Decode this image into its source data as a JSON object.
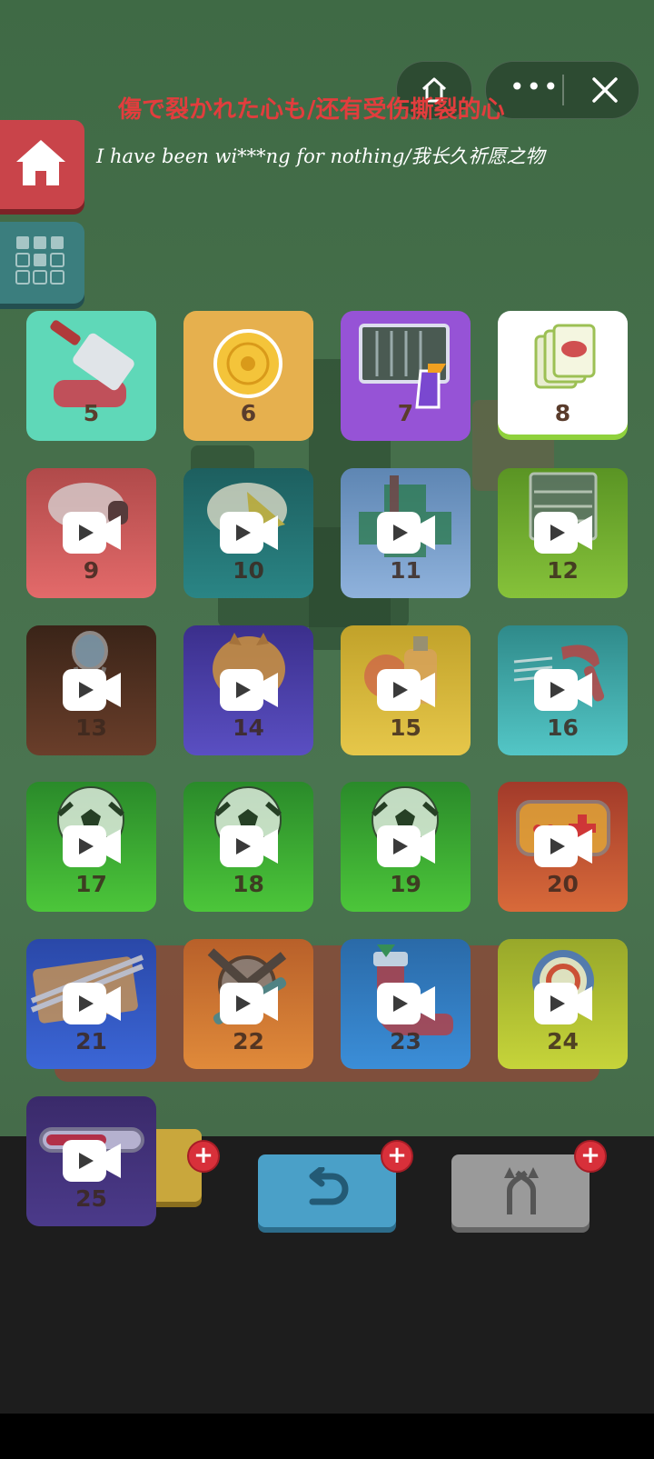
{
  "lyrics": {
    "line1": "傷で裂かれた心も/还有受伤撕裂的心",
    "line2": "I have been wi***ng for nothing/我长久祈愿之物"
  },
  "colors": {
    "background_green": "#456c4a",
    "lyric_red": "#e23d3d",
    "home_button": "#c9444a",
    "grid_button": "#3b7e7e",
    "plus_badge": "#d8303a"
  },
  "capsule": {
    "home_icon": "home-icon",
    "more_icon": "more-dots-icon",
    "close_icon": "close-icon"
  },
  "side": {
    "home_icon": "house-icon",
    "grid_icon": "grid-icon"
  },
  "levels": [
    {
      "number": "5",
      "item": "cleaver-meat",
      "locked": false
    },
    {
      "number": "6",
      "item": "mooncake",
      "locked": false
    },
    {
      "number": "7",
      "item": "grill-spray",
      "locked": false
    },
    {
      "number": "8",
      "item": "meat-tiles",
      "locked": false
    },
    {
      "number": "9",
      "item": "sheep",
      "locked": true
    },
    {
      "number": "10",
      "item": "plate-cheese",
      "locked": true
    },
    {
      "number": "11",
      "item": "pharmacy",
      "locked": true
    },
    {
      "number": "12",
      "item": "shelf",
      "locked": true
    },
    {
      "number": "13",
      "item": "mirror",
      "locked": true
    },
    {
      "number": "14",
      "item": "cat",
      "locked": true
    },
    {
      "number": "15",
      "item": "perfume",
      "locked": true
    },
    {
      "number": "16",
      "item": "hairdryer",
      "locked": true
    },
    {
      "number": "17",
      "item": "soccer-ball",
      "locked": true
    },
    {
      "number": "18",
      "item": "soccer-ball",
      "locked": true
    },
    {
      "number": "19",
      "item": "soccer-ball",
      "locked": true
    },
    {
      "number": "20",
      "item": "gamepad",
      "locked": true
    },
    {
      "number": "21",
      "item": "chopsticks-board",
      "locked": true
    },
    {
      "number": "22",
      "item": "grinder-tool",
      "locked": true
    },
    {
      "number": "23",
      "item": "christmas-stocking",
      "locked": true
    },
    {
      "number": "24",
      "item": "badge",
      "locked": true
    },
    {
      "number": "25",
      "item": "thermometer",
      "locked": true
    }
  ],
  "actions": {
    "undo_icon": "undo-arrow-icon",
    "shuffle_icon": "shuffle-arrows-icon",
    "plus_label": "+"
  }
}
